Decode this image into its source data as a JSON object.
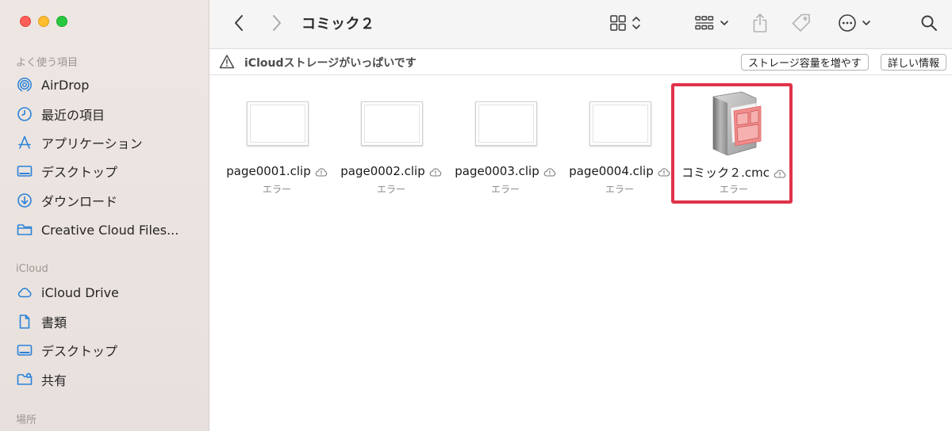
{
  "window": {
    "title": "コミック２"
  },
  "sidebar": {
    "favorites_header": "よく使う項目",
    "favorites": [
      {
        "label": "AirDrop",
        "icon": "airdrop-icon"
      },
      {
        "label": "最近の項目",
        "icon": "clock-icon"
      },
      {
        "label": "アプリケーション",
        "icon": "applications-icon"
      },
      {
        "label": "デスクトップ",
        "icon": "desktop-icon"
      },
      {
        "label": "ダウンロード",
        "icon": "download-icon"
      },
      {
        "label": "Creative Cloud Files...",
        "icon": "folder-icon"
      }
    ],
    "icloud_header": "iCloud",
    "icloud": [
      {
        "label": "iCloud Drive",
        "icon": "cloud-icon"
      },
      {
        "label": "書類",
        "icon": "document-icon"
      },
      {
        "label": "デスクトップ",
        "icon": "desktop-icon"
      },
      {
        "label": "共有",
        "icon": "shared-folder-icon"
      }
    ],
    "locations_header": "場所"
  },
  "infobar": {
    "message": "iCloudストレージがいっぱいです",
    "add_storage_button": "ストレージ容量を増やす",
    "details_button": "詳しい情報"
  },
  "files": [
    {
      "name": "page0001.clip",
      "status": "エラー",
      "kind": "clip"
    },
    {
      "name": "page0002.clip",
      "status": "エラー",
      "kind": "clip"
    },
    {
      "name": "page0003.clip",
      "status": "エラー",
      "kind": "clip"
    },
    {
      "name": "page0004.clip",
      "status": "エラー",
      "kind": "clip"
    },
    {
      "name": "コミック２.cmc",
      "status": "エラー",
      "kind": "cmc"
    }
  ],
  "colors": {
    "accent": "#2a82d8",
    "highlight": "#e0334a",
    "sidebar_bg": "#ede6e2"
  }
}
